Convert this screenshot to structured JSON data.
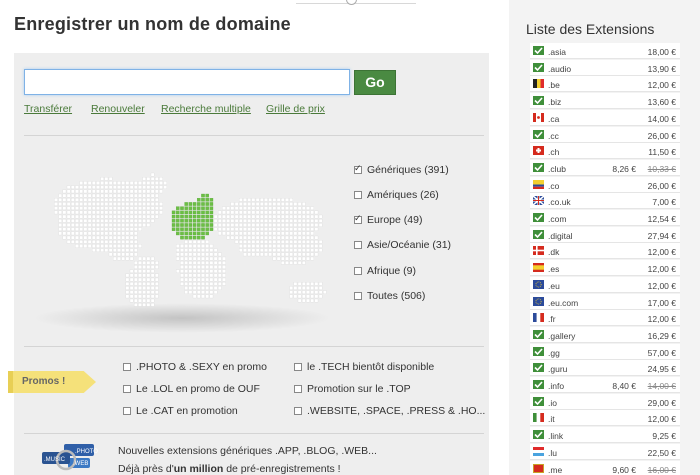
{
  "colors": {
    "accent_green": "#4a8a42",
    "link_green": "#4a7a3a",
    "europe_green": "#6cbf45",
    "promo_yellow": "#f5e17a"
  },
  "main": {
    "title": "Enregistrer un nom de domaine",
    "search": {
      "value": "",
      "placeholder": ""
    },
    "go_label": "Go",
    "links": [
      {
        "label": "Transférer"
      },
      {
        "label": "Renouveler"
      },
      {
        "label": "Recherche multiple"
      },
      {
        "label": "Grille de prix"
      }
    ],
    "regions": [
      {
        "label": "Génériques (391)",
        "checked": true
      },
      {
        "label": "Amériques (26)",
        "checked": false
      },
      {
        "label": "Europe (49)",
        "checked": true
      },
      {
        "label": "Asie/Océanie (31)",
        "checked": false
      },
      {
        "label": "Afrique (9)",
        "checked": false
      },
      {
        "label": "Toutes (506)",
        "checked": false
      }
    ],
    "promo_tag": "Promos !",
    "promos": [
      {
        "label": ".PHOTO & .SEXY en promo",
        "checked": false
      },
      {
        "label": "le .TECH bientôt disponible",
        "checked": false
      },
      {
        "label": "Le .LOL en promo de OUF",
        "checked": false
      },
      {
        "label": "Promotion sur le .TOP",
        "checked": false
      },
      {
        "label": "Le .CAT en promotion",
        "checked": false
      },
      {
        "label": ".WEBSITE, .SPACE, .PRESS & .HO...",
        "checked": false
      }
    ],
    "news_icon_labels": {
      "music": ".MUSIC",
      "photo": ".PHOTO",
      "web": ".WEB"
    },
    "news": {
      "line1": "Nouvelles extensions génériques .APP, .BLOG, .WEB...",
      "line2_pre": "Déjà près d'",
      "line2_bold": "un million",
      "line2_post": " de pré-enregistrements !"
    }
  },
  "sidebar": {
    "title": "Liste des Extensions",
    "extensions": [
      {
        "name": ".asia",
        "price": "18,00 €",
        "flag": "check"
      },
      {
        "name": ".audio",
        "price": "13,90 €",
        "flag": "check"
      },
      {
        "name": ".be",
        "price": "12,00 €",
        "flag": "be"
      },
      {
        "name": ".biz",
        "price": "13,60 €",
        "flag": "check"
      },
      {
        "name": ".ca",
        "price": "14,00 €",
        "flag": "ca"
      },
      {
        "name": ".cc",
        "price": "26,00 €",
        "flag": "check"
      },
      {
        "name": ".ch",
        "price": "11,50 €",
        "flag": "ch"
      },
      {
        "name": ".club",
        "promo": "8,26 €",
        "price": "10,33 €",
        "old": true,
        "flag": "check"
      },
      {
        "name": ".co",
        "price": "26,00 €",
        "flag": "co"
      },
      {
        "name": ".co.uk",
        "price": "7,00 €",
        "flag": "uk"
      },
      {
        "name": ".com",
        "price": "12,54 €",
        "flag": "check"
      },
      {
        "name": ".digital",
        "price": "27,94 €",
        "flag": "check"
      },
      {
        "name": ".dk",
        "price": "12,00 €",
        "flag": "dk"
      },
      {
        "name": ".es",
        "price": "12,00 €",
        "flag": "es"
      },
      {
        "name": ".eu",
        "price": "12,00 €",
        "flag": "eu"
      },
      {
        "name": ".eu.com",
        "price": "17,00 €",
        "flag": "eu"
      },
      {
        "name": ".fr",
        "price": "12,00 €",
        "flag": "fr"
      },
      {
        "name": ".gallery",
        "price": "16,29 €",
        "flag": "check"
      },
      {
        "name": ".gg",
        "price": "57,00 €",
        "flag": "check"
      },
      {
        "name": ".guru",
        "price": "24,95 €",
        "flag": "check"
      },
      {
        "name": ".info",
        "promo": "8,40 €",
        "price": "14,00 €",
        "old": true,
        "flag": "check"
      },
      {
        "name": ".io",
        "price": "29,00 €",
        "flag": "check"
      },
      {
        "name": ".it",
        "price": "12,00 €",
        "flag": "it"
      },
      {
        "name": ".link",
        "price": "9,25 €",
        "flag": "check"
      },
      {
        "name": ".lu",
        "price": "22,50 €",
        "flag": "lu"
      },
      {
        "name": ".me",
        "promo": "9,60 €",
        "price": "16,00 €",
        "old": true,
        "flag": "me"
      }
    ]
  }
}
